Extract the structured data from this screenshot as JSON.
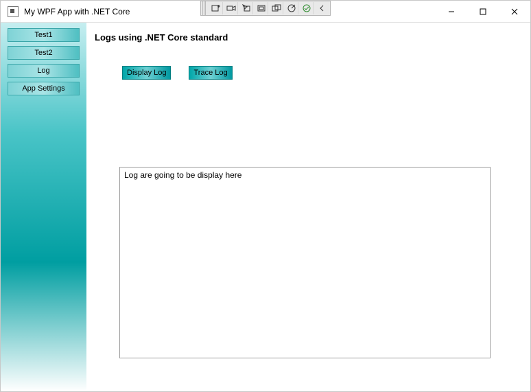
{
  "window": {
    "title": "My WPF App with .NET Core"
  },
  "debug_toolbar": {
    "items": [
      "add-window",
      "camcorder",
      "pointer-rect",
      "rect",
      "overlap-rect",
      "target",
      "ok",
      "chevron-left"
    ]
  },
  "sidebar": {
    "items": [
      {
        "label": "Test1"
      },
      {
        "label": "Test2"
      },
      {
        "label": "Log"
      },
      {
        "label": "App Settings"
      }
    ]
  },
  "main": {
    "heading": "Logs using .NET Core standard",
    "buttons": {
      "display": "Display Log",
      "trace": "Trace Log"
    },
    "log_placeholder": "Log are going to be display here"
  }
}
